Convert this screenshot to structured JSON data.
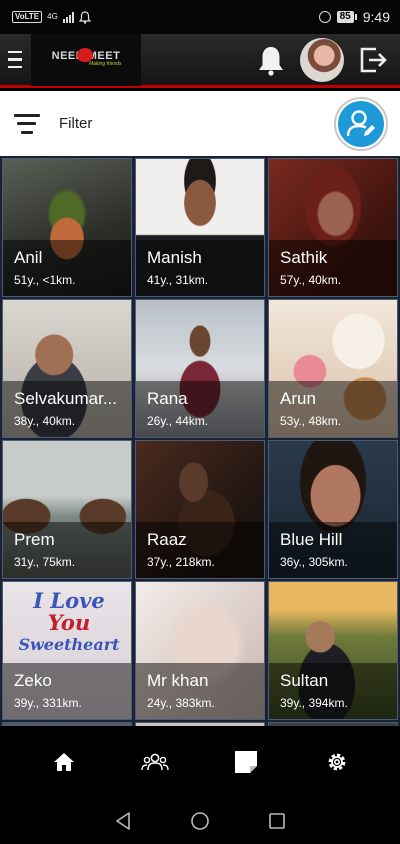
{
  "status_bar": {
    "volte": "VoLTE",
    "network": "4G",
    "battery": "85",
    "time": "9:49"
  },
  "header": {
    "logo_text": "NEED MEET",
    "logo_tagline": "Making friends",
    "icons": [
      "menu-icon",
      "bell-icon",
      "avatar",
      "logout-icon"
    ]
  },
  "filter": {
    "label": "Filter"
  },
  "profiles": [
    {
      "name": "Anil",
      "meta": "51y., <1km."
    },
    {
      "name": "Manish",
      "meta": "41y., 31km."
    },
    {
      "name": "Sathik",
      "meta": "57y., 40km."
    },
    {
      "name": "Selvakumar...",
      "meta": "38y., 40km."
    },
    {
      "name": "Rana",
      "meta": "26y., 44km."
    },
    {
      "name": "Arun",
      "meta": "53y., 48km."
    },
    {
      "name": "Prem",
      "meta": "31y., 75km."
    },
    {
      "name": "Raaz",
      "meta": "37y., 218km."
    },
    {
      "name": "Blue Hill",
      "meta": "36y., 305km."
    },
    {
      "name": "Zeko",
      "meta": "39y., 331km."
    },
    {
      "name": "Mr khan",
      "meta": "24y., 383km."
    },
    {
      "name": "Sultan",
      "meta": "39y., 394km."
    }
  ],
  "zeko_image_text": {
    "line1": "I Love",
    "line2": "You",
    "line3": "Sweetheart"
  },
  "bottom_nav": [
    "home-icon",
    "people-icon",
    "pages-icon",
    "settings-icon"
  ],
  "colors": {
    "accent_red": "#c00000",
    "grid_bg": "#1b2231",
    "edit_blue": "#1e9ad8"
  }
}
